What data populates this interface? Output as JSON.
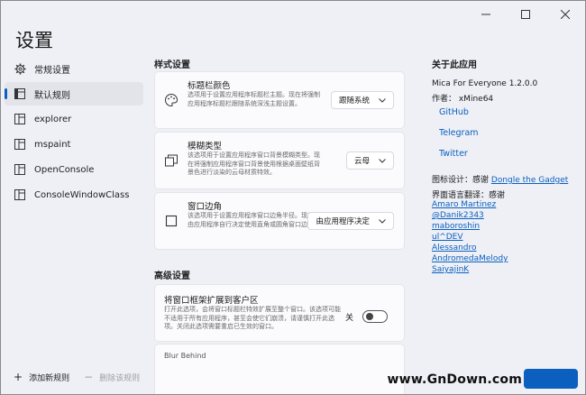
{
  "window": {
    "title": "设置",
    "caption": [
      "minimize",
      "maximize",
      "close"
    ]
  },
  "sidebar": {
    "items": [
      {
        "label": "常规设置",
        "icon": "gear-icon",
        "active": false
      },
      {
        "label": "默认规则",
        "icon": "rule-icon",
        "active": true
      },
      {
        "label": "explorer",
        "icon": "window-icon",
        "active": false
      },
      {
        "label": "mspaint",
        "icon": "window-icon",
        "active": false
      },
      {
        "label": "OpenConsole",
        "icon": "window-icon",
        "active": false
      },
      {
        "label": "ConsoleWindowClass",
        "icon": "window-icon",
        "active": false
      }
    ],
    "add_label": "添加新规则",
    "delete_label": "删除该规则"
  },
  "main": {
    "style_section": "样式设置",
    "cards": [
      {
        "title": "标题栏颜色",
        "desc": "选项用于设置应用程序标题栏主题。现在将强制应用程序标题栏跟随系统深浅主题设置。",
        "value": "跟随系统",
        "icon": "palette-icon"
      },
      {
        "title": "模糊类型",
        "desc": "该选项用于设置应用程序窗口背景模糊类型。现在将强制应用程序窗口背景使用根据桌面壁纸背景色进行淡染的云母材质特效。",
        "value": "云母",
        "icon": "layers-icon"
      },
      {
        "title": "窗口边角",
        "desc": "该选项用于设置应用程序窗口边角半径。现在将由应用程序自行决定使用直角或圆角窗口边框。",
        "value": "由应用程序决定",
        "icon": "square-icon"
      }
    ],
    "advanced_section": "高级设置",
    "extend_frame": {
      "title": "将窗口框架扩展到客户区",
      "desc": "打开此选项，会将窗口标题栏特效扩展至整个窗口。该选项可能不适用于所有应用程序，甚至会使它们崩溃，请谨慎打开此选项。关闭此选项需要重启已生效的窗口。",
      "toggle_label": "关",
      "toggle_on": false
    },
    "partial_card_title": "Blur Behind"
  },
  "about": {
    "heading": "关于此应用",
    "version": "Mica For Everyone 1.2.0.0",
    "author": "作者： xMine64",
    "links": [
      "GitHub",
      "Telegram",
      "Twitter"
    ],
    "icon_credit_prefix": "图标设计：感谢",
    "icon_credit_name": "Dongle the Gadget",
    "translation_credit": "界面语言翻译：感谢",
    "translators": [
      "Amaro Martinez",
      "@Danik2343",
      "maboroshin",
      "ul^DEV",
      "Alessandro",
      "AndromedaMelody",
      "SaiyajinK"
    ]
  },
  "watermark": "www.GnDown.com",
  "colors": {
    "accent": "#0b5fbf",
    "background": "#eef0f6",
    "card": "#fbfbfd"
  }
}
